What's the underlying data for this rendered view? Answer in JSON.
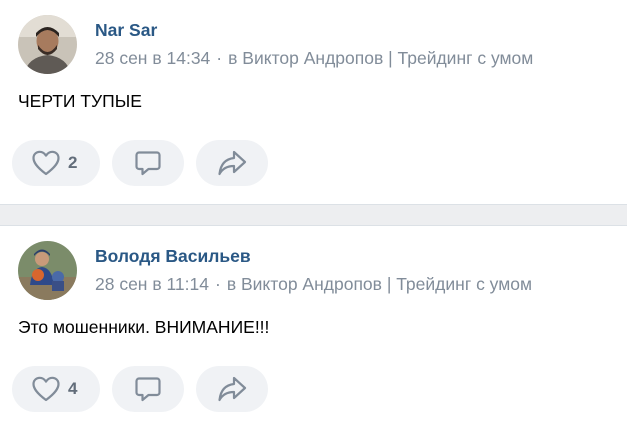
{
  "posts": [
    {
      "author": "Nar Sar",
      "date": "28 сен в 14:34",
      "separator": "·",
      "reply_to": "в Виктор Андропов | Трейдинг с умом",
      "text": "ЧЕРТИ ТУПЫЕ",
      "likes": "2",
      "avatar_icon": "user-avatar-photo",
      "like_icon": "heart-icon",
      "comment_icon": "comment-icon",
      "share_icon": "share-icon"
    },
    {
      "author": "Володя Васильев",
      "date": "28 сен в 11:14",
      "separator": "·",
      "reply_to": "в Виктор Андропов | Трейдинг с умом",
      "text": "Это мошенники. ВНИМАНИЕ!!!",
      "likes": "4",
      "avatar_icon": "user-avatar-photo",
      "like_icon": "heart-icon",
      "comment_icon": "comment-icon",
      "share_icon": "share-icon"
    }
  ],
  "colors": {
    "author": "#2a5885",
    "meta": "#818c99",
    "button_bg": "#f0f2f5",
    "icon": "#818c99",
    "separator_bg": "#edeef0"
  }
}
